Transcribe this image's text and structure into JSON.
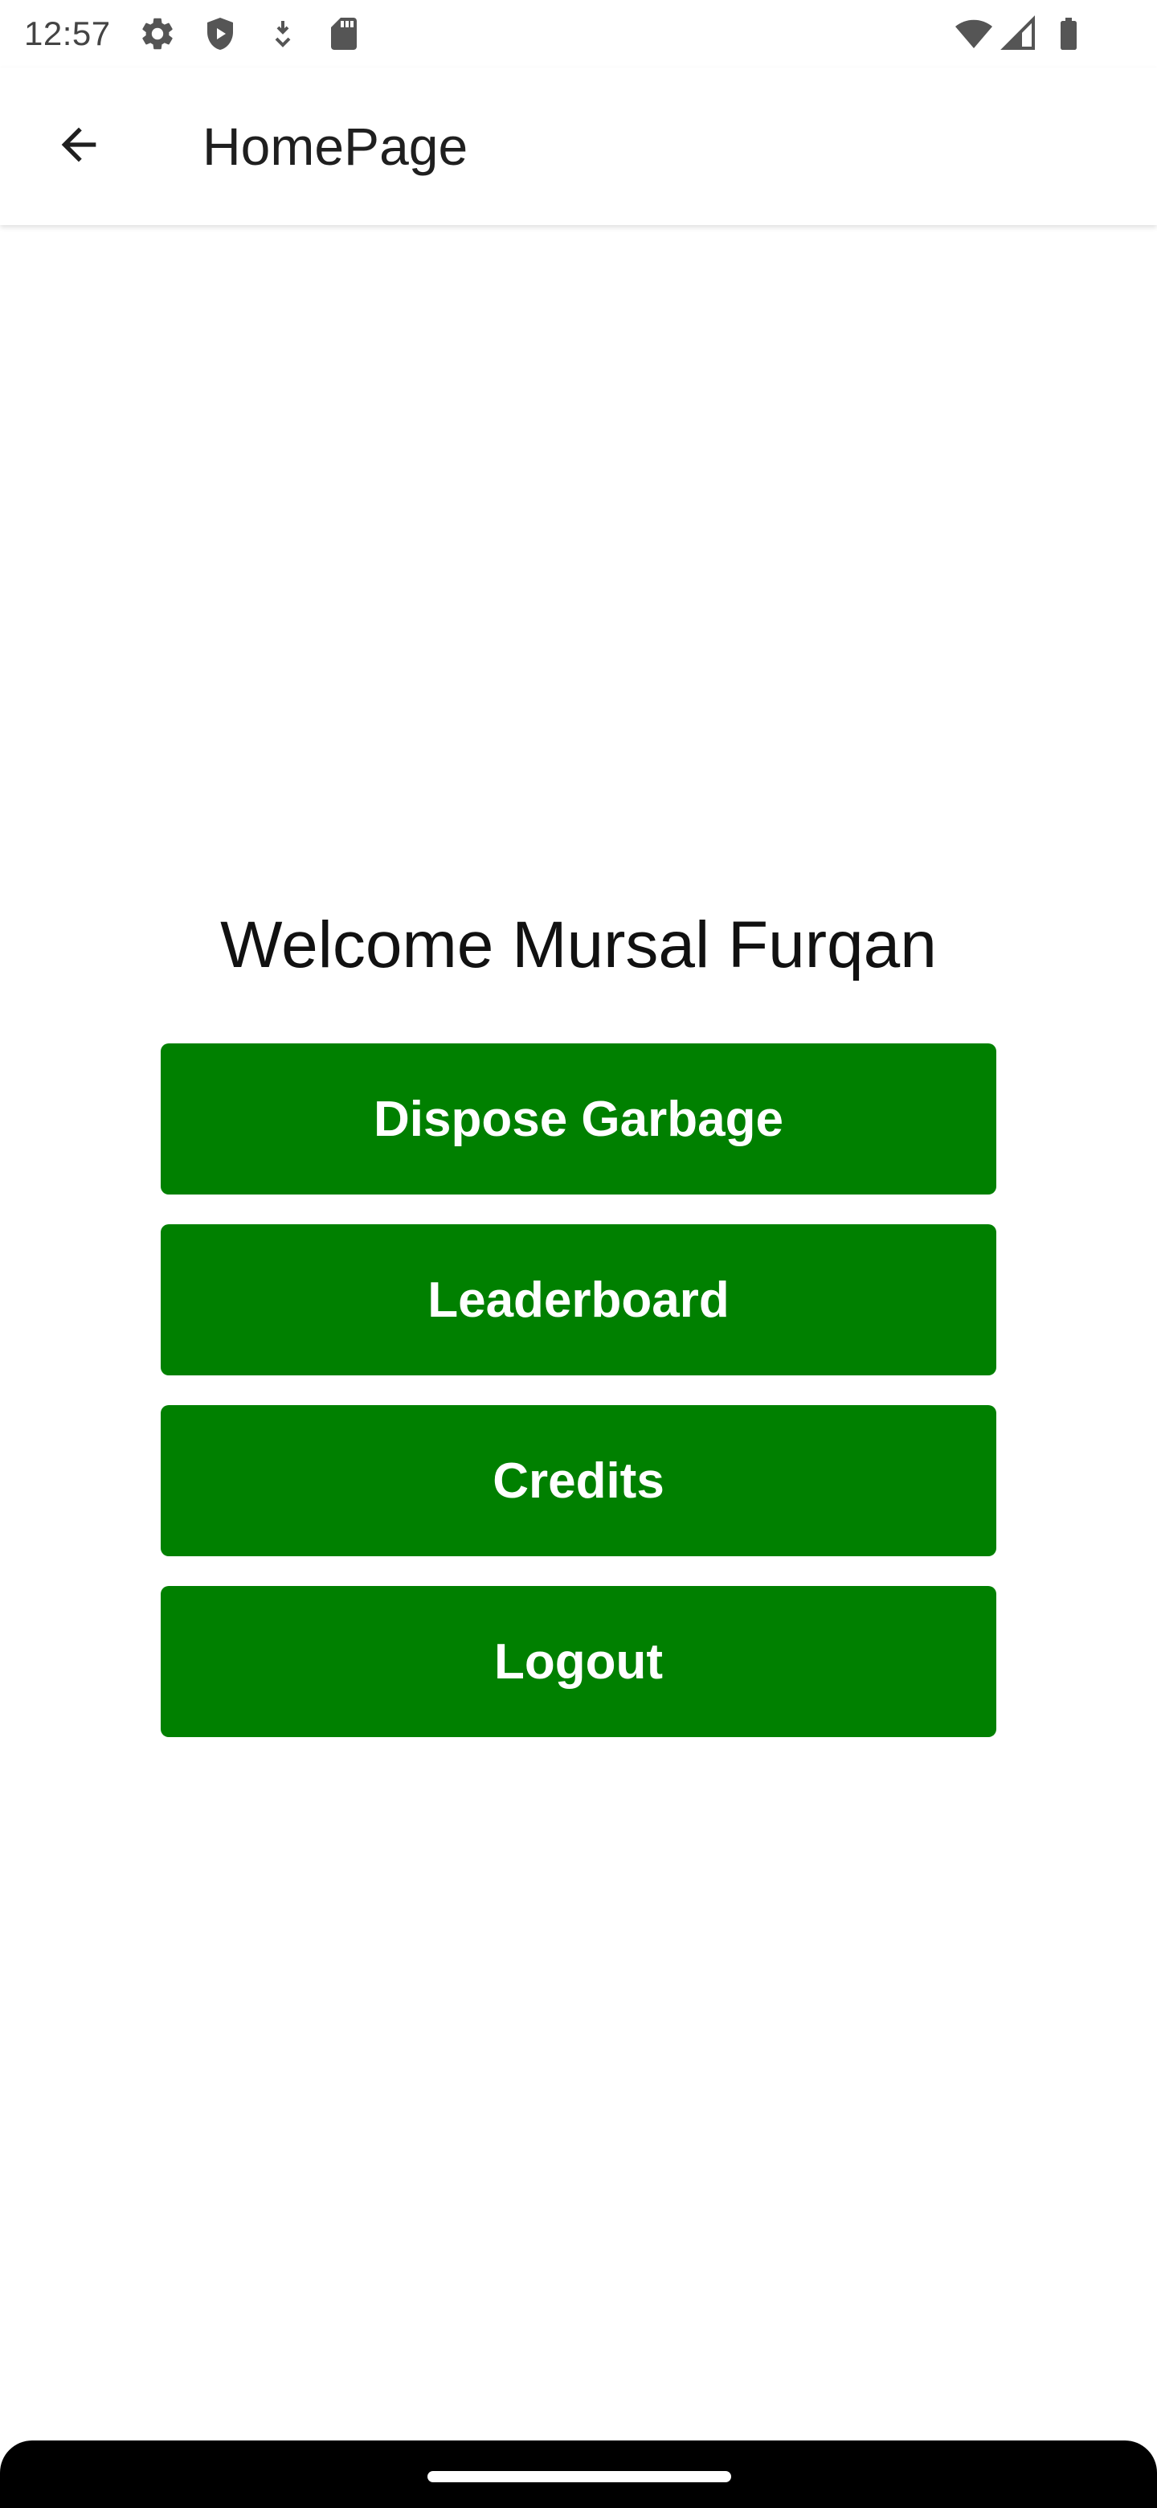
{
  "status_bar": {
    "time": "12:57",
    "icons": [
      "settings-gear-icon",
      "shield-play-icon",
      "download-icon",
      "sd-card-icon",
      "wifi-icon",
      "cell-signal-icon",
      "battery-icon"
    ]
  },
  "app_bar": {
    "back_icon": "arrow-back-icon",
    "title": "HomePage"
  },
  "main": {
    "welcome_text": "Welcome Mursal Furqan",
    "buttons": [
      {
        "label": "Dispose Garbage"
      },
      {
        "label": "Leaderboard"
      },
      {
        "label": "Credits"
      },
      {
        "label": "Logout"
      }
    ]
  },
  "colors": {
    "button_background": "#008000",
    "button_text": "#ffffff",
    "background": "#ffffff"
  }
}
